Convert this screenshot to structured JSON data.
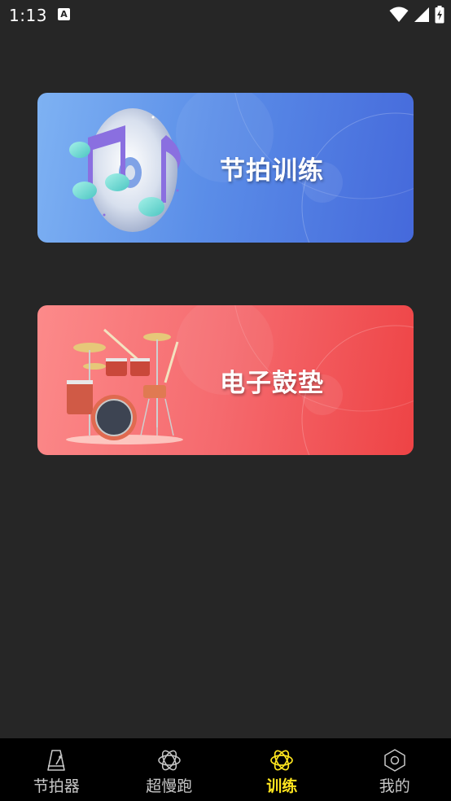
{
  "status_bar": {
    "time": "1:13",
    "notification_badge": "A",
    "icons": [
      "wifi-icon",
      "signal-icon",
      "battery-charging-icon"
    ]
  },
  "cards": [
    {
      "title": "节拍训练",
      "illustration": "music-notes-disc-icon",
      "gradient": [
        "#7eb2f3",
        "#4569db"
      ]
    },
    {
      "title": "电子鼓垫",
      "illustration": "drum-kit-icon",
      "gradient": [
        "#fc8a8a",
        "#ee4345"
      ]
    }
  ],
  "bottom_nav": {
    "items": [
      {
        "label": "节拍器",
        "icon": "metronome-icon",
        "active": false
      },
      {
        "label": "超慢跑",
        "icon": "atom-icon",
        "active": false
      },
      {
        "label": "训练",
        "icon": "atom-icon",
        "active": true
      },
      {
        "label": "我的",
        "icon": "hexagon-icon",
        "active": false
      }
    ],
    "active_color": "#ffe61f",
    "inactive_color": "#c8c8c8"
  }
}
